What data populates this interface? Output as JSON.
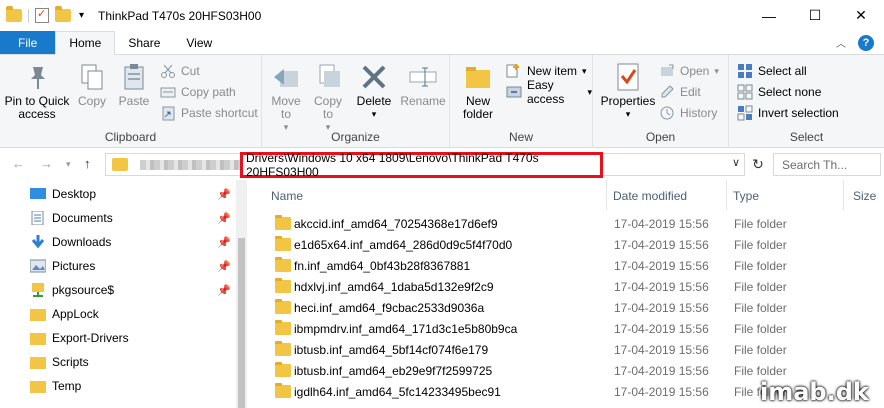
{
  "window": {
    "title": "ThinkPad T470s 20HFS03H00",
    "minimize": "—",
    "maximize": "☐",
    "close": "✕"
  },
  "tabs": [
    "File",
    "Home",
    "Share",
    "View"
  ],
  "ribbon": {
    "clipboard": {
      "label": "Clipboard",
      "pin": "Pin to Quick access",
      "copy": "Copy",
      "paste": "Paste",
      "cut": "Cut",
      "copy_path": "Copy path",
      "paste_shortcut": "Paste shortcut"
    },
    "organize": {
      "label": "Organize",
      "move_to": "Move to",
      "copy_to": "Copy to",
      "delete": "Delete",
      "rename": "Rename"
    },
    "new": {
      "label": "New",
      "new_folder": "New folder",
      "new_item": "New item",
      "easy_access": "Easy access"
    },
    "open": {
      "label": "Open",
      "properties": "Properties",
      "open": "Open",
      "edit": "Edit",
      "history": "History"
    },
    "select": {
      "label": "Select",
      "select_all": "Select all",
      "select_none": "Select none",
      "invert": "Invert selection"
    }
  },
  "address": {
    "path": "Drivers\\Windows 10 x64 1809\\Lenovo\\ThinkPad T470s 20HFS03H00",
    "search_placeholder": "Search Th..."
  },
  "nav_pane": [
    {
      "label": "Desktop",
      "icon": "desktop-icon",
      "pinned": true
    },
    {
      "label": "Documents",
      "icon": "documents-icon",
      "pinned": true
    },
    {
      "label": "Downloads",
      "icon": "downloads-icon",
      "pinned": true
    },
    {
      "label": "Pictures",
      "icon": "pictures-icon",
      "pinned": true
    },
    {
      "label": "pkgsource$",
      "icon": "network-share-icon",
      "pinned": true
    },
    {
      "label": "AppLock",
      "icon": "folder-icon",
      "pinned": false
    },
    {
      "label": "Export-Drivers",
      "icon": "folder-icon",
      "pinned": false
    },
    {
      "label": "Scripts",
      "icon": "folder-icon",
      "pinned": false
    },
    {
      "label": "Temp",
      "icon": "folder-icon",
      "pinned": false
    }
  ],
  "columns": {
    "name": "Name",
    "date": "Date modified",
    "type": "Type",
    "size": "Size"
  },
  "files": [
    {
      "name": "akccid.inf_amd64_70254368e17d6ef9",
      "date": "17-04-2019 15:56",
      "type": "File folder"
    },
    {
      "name": "e1d65x64.inf_amd64_286d0d9c5f4f70d0",
      "date": "17-04-2019 15:56",
      "type": "File folder"
    },
    {
      "name": "fn.inf_amd64_0bf43b28f8367881",
      "date": "17-04-2019 15:56",
      "type": "File folder"
    },
    {
      "name": "hdxlvj.inf_amd64_1daba5d132e9f2c9",
      "date": "17-04-2019 15:56",
      "type": "File folder"
    },
    {
      "name": "heci.inf_amd64_f9cbac2533d9036a",
      "date": "17-04-2019 15:56",
      "type": "File folder"
    },
    {
      "name": "ibmpmdrv.inf_amd64_171d3c1e5b80b9ca",
      "date": "17-04-2019 15:56",
      "type": "File folder"
    },
    {
      "name": "ibtusb.inf_amd64_5bf14cf074f6e179",
      "date": "17-04-2019 15:56",
      "type": "File folder"
    },
    {
      "name": "ibtusb.inf_amd64_eb29e9f7f2599725",
      "date": "17-04-2019 15:56",
      "type": "File folder"
    },
    {
      "name": "igdlh64.inf_amd64_5fc14233495bec91",
      "date": "17-04-2019 15:56",
      "type": "File folder"
    }
  ],
  "watermark": "imab.dk"
}
